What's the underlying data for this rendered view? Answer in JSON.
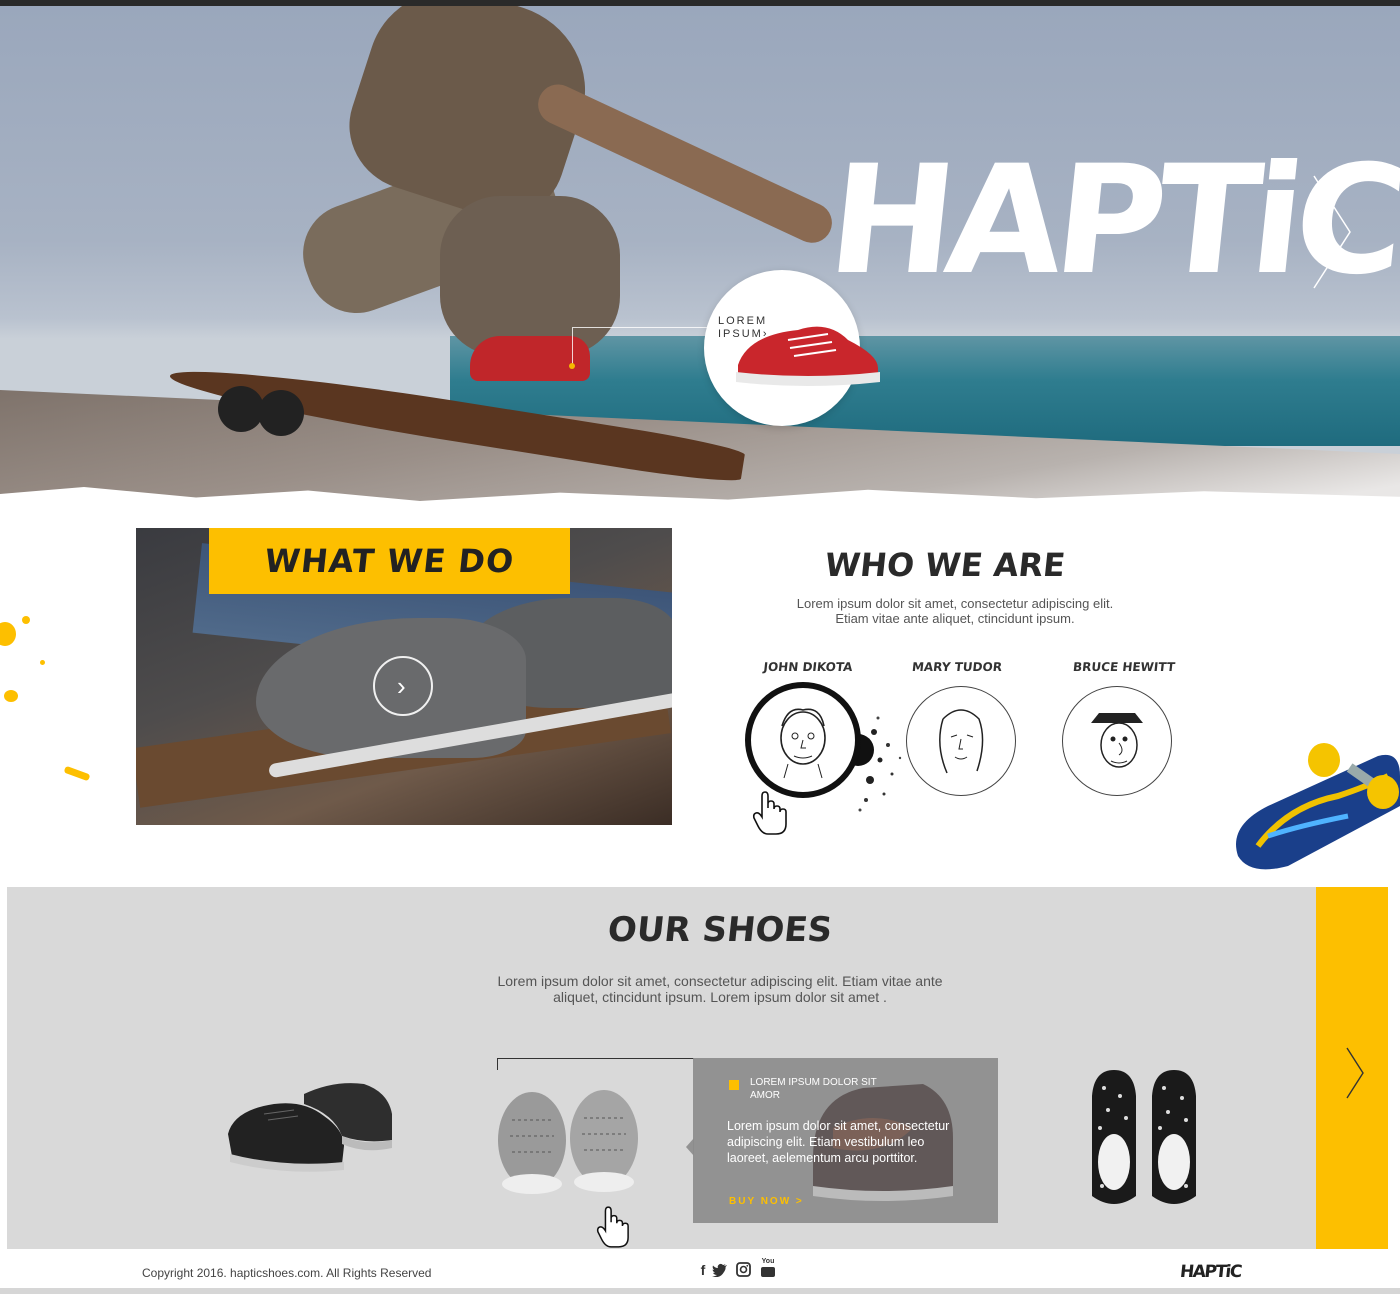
{
  "hero": {
    "logo": "HAPTiC",
    "callout": "LOREM IPSUM›"
  },
  "what_we_do": {
    "title": "WHAT WE DO"
  },
  "who_we_are": {
    "title": "WHO WE ARE",
    "description_line1": "Lorem ipsum dolor sit amet, consectetur adipiscing elit.",
    "description_line2": "Etiam vitae ante aliquet, ctincidunt ipsum.",
    "team": [
      {
        "name": "JOHN DIKOTA"
      },
      {
        "name": "MARY TUDOR"
      },
      {
        "name": "BRUCE HEWITT"
      }
    ]
  },
  "our_shoes": {
    "title": "OUR SHOES",
    "description_line1": "Lorem ipsum dolor sit amet, consectetur adipiscing elit. Etiam vitae ante",
    "description_line2": "aliquet, ctincidunt ipsum. Lorem ipsum dolor sit amet .",
    "card": {
      "title": "LOREM IPSUM DOLOR SIT AMOR",
      "body": "Lorem ipsum dolor sit amet, consectetur adipiscing elit. Etiam vestibulum leo laoreet, aelementum arcu porttitor.",
      "cta": "BUY NOW >"
    }
  },
  "footer": {
    "copyright": "Copyright 2016. hapticshoes.com. All Rights Reserved",
    "social": {
      "facebook": "f",
      "youtube": "You"
    },
    "logo": "HAPTiC"
  },
  "colors": {
    "accent": "#fdbf00",
    "dark": "#2a2a2a",
    "panel": "#d9d9d9"
  },
  "icons": [
    "chevron-right-icon",
    "play-icon",
    "hand-cursor-icon",
    "facebook-icon",
    "twitter-icon",
    "instagram-icon",
    "youtube-icon"
  ]
}
